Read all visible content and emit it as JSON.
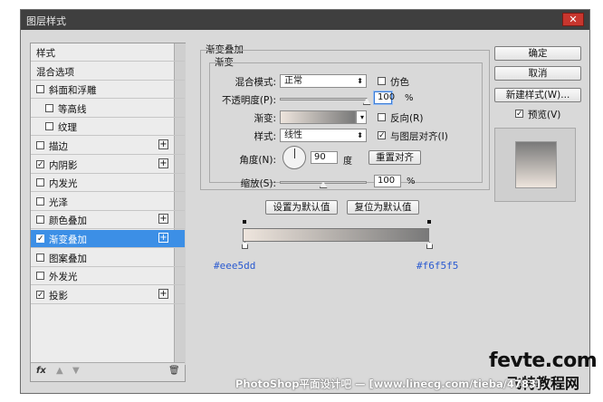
{
  "window": {
    "title": "图层样式",
    "close_glyph": "✕"
  },
  "sidebar": {
    "items": [
      {
        "label": "样式",
        "checkbox": false,
        "checked": false,
        "plus": false,
        "selected": false,
        "indent": 0
      },
      {
        "label": "混合选项",
        "checkbox": false,
        "checked": false,
        "plus": false,
        "selected": false,
        "indent": 0
      },
      {
        "label": "斜面和浮雕",
        "checkbox": true,
        "checked": false,
        "plus": false,
        "selected": false,
        "indent": 0
      },
      {
        "label": "等高线",
        "checkbox": true,
        "checked": false,
        "plus": false,
        "selected": false,
        "indent": 1
      },
      {
        "label": "纹理",
        "checkbox": true,
        "checked": false,
        "plus": false,
        "selected": false,
        "indent": 1
      },
      {
        "label": "描边",
        "checkbox": true,
        "checked": false,
        "plus": true,
        "selected": false,
        "indent": 0
      },
      {
        "label": "内阴影",
        "checkbox": true,
        "checked": true,
        "plus": true,
        "selected": false,
        "indent": 0
      },
      {
        "label": "内发光",
        "checkbox": true,
        "checked": false,
        "plus": false,
        "selected": false,
        "indent": 0
      },
      {
        "label": "光泽",
        "checkbox": true,
        "checked": false,
        "plus": false,
        "selected": false,
        "indent": 0
      },
      {
        "label": "颜色叠加",
        "checkbox": true,
        "checked": false,
        "plus": true,
        "selected": false,
        "indent": 0
      },
      {
        "label": "渐变叠加",
        "checkbox": true,
        "checked": true,
        "plus": true,
        "selected": true,
        "indent": 0
      },
      {
        "label": "图案叠加",
        "checkbox": true,
        "checked": false,
        "plus": false,
        "selected": false,
        "indent": 0
      },
      {
        "label": "外发光",
        "checkbox": true,
        "checked": false,
        "plus": false,
        "selected": false,
        "indent": 0
      },
      {
        "label": "投影",
        "checkbox": true,
        "checked": true,
        "plus": true,
        "selected": false,
        "indent": 0
      }
    ],
    "footer": {
      "fx": "fx",
      "up": "▲",
      "down": "▼",
      "trash": "🗑"
    }
  },
  "panel": {
    "group_title": "渐变叠加",
    "subgroup_title": "渐变",
    "blend_mode": {
      "label": "混合模式:",
      "value": "正常"
    },
    "dither": {
      "label": "仿色",
      "checked": false
    },
    "opacity": {
      "label": "不透明度(P):",
      "value": "100",
      "unit": "%",
      "level": 1.0
    },
    "gradient": {
      "label": "渐变:",
      "start_color": "#eee5dd",
      "end_color": "#797979"
    },
    "reverse": {
      "label": "反向(R)",
      "checked": false
    },
    "style": {
      "label": "样式:",
      "value": "线性"
    },
    "align": {
      "label": "与图层对齐(I)",
      "checked": true
    },
    "angle": {
      "label": "角度(N):",
      "value": "90",
      "unit": "度"
    },
    "reset_align_button": "重置对齐",
    "scale": {
      "label": "缩放(S):",
      "value": "100",
      "unit": "%",
      "level": 0.5
    },
    "set_default_button": "设置为默认值",
    "reset_default_button": "复位为默认值"
  },
  "gradient_editor": {
    "left_hex": "#eee5dd",
    "right_hex": "#f6f5f5"
  },
  "actions": {
    "ok": "确定",
    "cancel": "取消",
    "new_style": "新建样式(W)...",
    "preview_label": "预览(V)",
    "preview_checked": true
  },
  "watermark": {
    "footer": "PhotoShop平面设计吧 — [www.linecg.com/tieba/4783]",
    "logo_line1": "fevte.com",
    "logo_line2": "飞特教程网"
  }
}
